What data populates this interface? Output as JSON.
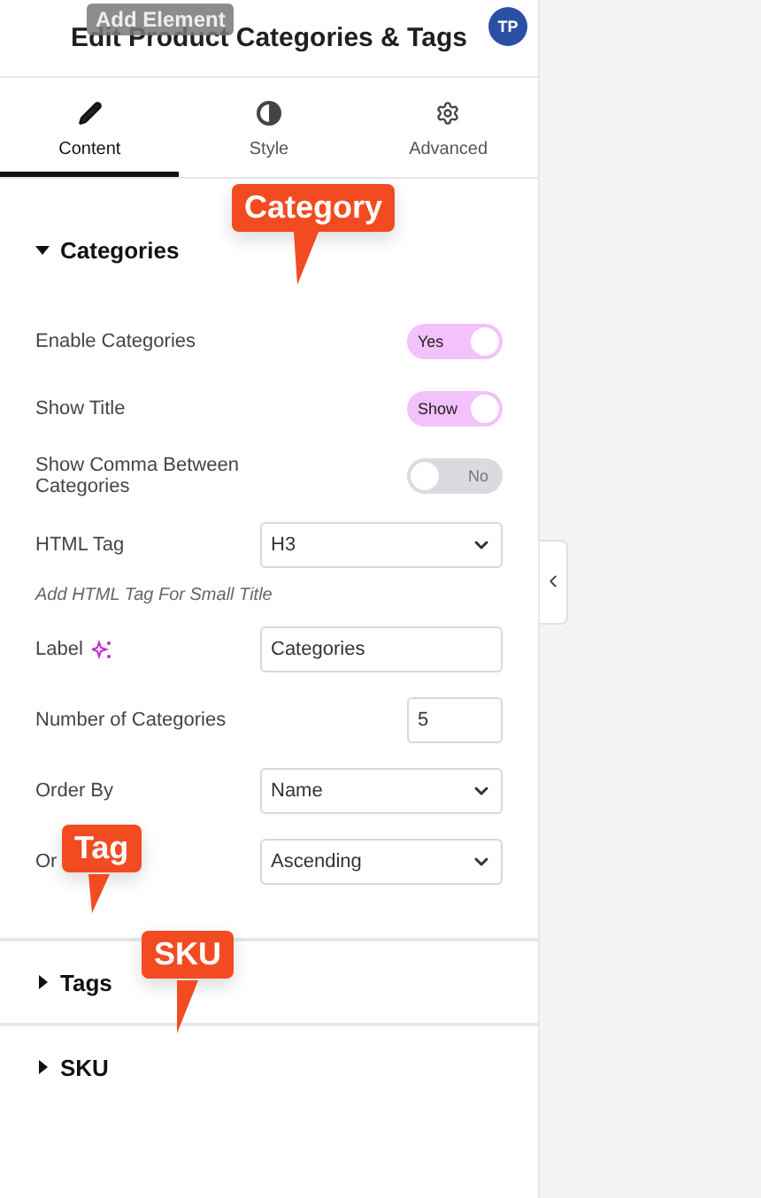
{
  "header": {
    "title": "Edit Product Categories & Tags",
    "tooltip": "Add Element",
    "avatar": "TP"
  },
  "tabs": [
    {
      "label": "Content",
      "kind": "pencil",
      "selected": true
    },
    {
      "label": "Style",
      "kind": "contrast",
      "selected": false
    },
    {
      "label": "Advanced",
      "kind": "gear",
      "selected": false
    }
  ],
  "sections": [
    {
      "title": "Categories",
      "expanded": true,
      "callout": "Category",
      "controls": [
        {
          "kind": "toggle",
          "label": "Enable Categories",
          "on": true,
          "text": "Yes"
        },
        {
          "kind": "toggle",
          "label": "Show Title",
          "on": true,
          "text": "Show"
        },
        {
          "kind": "toggle",
          "label": "Show Comma Between Categories",
          "on": false,
          "text": "No"
        },
        {
          "kind": "select",
          "label": "HTML Tag",
          "value": "H3"
        },
        {
          "kind": "hint",
          "label": "Add HTML Tag For Small Title"
        },
        {
          "kind": "text",
          "label": "Label",
          "ai": true,
          "value": "Categories"
        },
        {
          "kind": "number",
          "label": "Number of Categories",
          "value": "5"
        },
        {
          "kind": "select",
          "label": "Order By",
          "value": "Name"
        },
        {
          "kind": "select",
          "label": "Or",
          "value": "Ascending",
          "callout": "Tag"
        }
      ]
    },
    {
      "title": "Tags",
      "expanded": false,
      "callout": "SKU"
    },
    {
      "title": "SKU",
      "expanded": false
    }
  ]
}
